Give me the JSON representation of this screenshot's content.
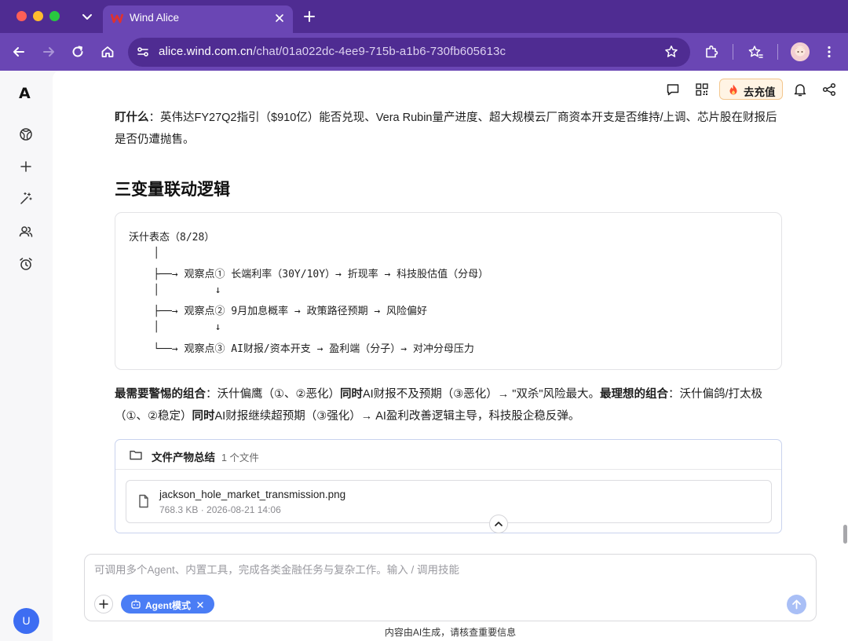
{
  "browser": {
    "tab_title": "Wind Alice",
    "url_host": "alice.wind.com.cn",
    "url_path": "/chat/01a022dc-4ee9-715b-a1b6-730fb605613c"
  },
  "sidebar": {
    "logo": "A",
    "items": [
      "explore-icon",
      "plus-icon",
      "magic-wand-icon",
      "users-icon",
      "alarm-icon"
    ],
    "avatar_initial": "U"
  },
  "header": {
    "recharge_label": "去充值"
  },
  "message": {
    "watch_label": "盯什么",
    "watch_text": "：英伟达FY27Q2指引（$910亿）能否兑现、Vera Rubin量产进度、超大规模云厂商资本开支是否维持/上调、芯片股在财报后是否仍遭抛售。",
    "section_title": "三变量联动逻辑",
    "diagram_lines": [
      "沃什表态（8/28）",
      "    │",
      "    ├──→ 观察点① 长端利率（30Y/10Y）→ 折现率 → 科技股估值（分母）",
      "    │         ↓",
      "    ├──→ 观察点② 9月加息概率 → 政策路径预期 → 风险偏好",
      "    │         ↓",
      "    └──→ 观察点③ AI财报/资本开支 → 盈利端（分子）→ 对冲分母压力"
    ],
    "conclusion": {
      "worst_label": "最需要警惕的组合",
      "worst_text_1": "：沃什偏鹰（①、②恶化）",
      "worst_bold": "同时",
      "worst_text_2": "AI财报不及预期（③恶化）→ \"双杀\"风险最大。",
      "best_label": "最理想的组合",
      "best_text_1": "：沃什偏鸽/打太极（①、②稳定）",
      "best_bold": "同时",
      "best_text_2": "AI财报继续超预期（③强化）→ AI盈利改善逻辑主导，科技股企稳反弹。"
    }
  },
  "files": {
    "title": "文件产物总结",
    "count": "1 个文件",
    "items": [
      {
        "name": "jackson_hole_market_transmission.png",
        "meta": "768.3 KB · 2026-08-21 14:06"
      }
    ]
  },
  "composer": {
    "placeholder": "可调用多个Agent、内置工具，完成各类金融任务与复杂工作。输入 / 调用技能",
    "agent_chip_label": "Agent模式"
  },
  "footer": {
    "disclaimer": "内容由AI生成，请核查重要信息"
  },
  "colors": {
    "browser_frame": "#4f2c92",
    "toolbar": "#6a46b4",
    "accent_blue": "#4a7df5",
    "recharge_bg": "#fff4e4"
  }
}
